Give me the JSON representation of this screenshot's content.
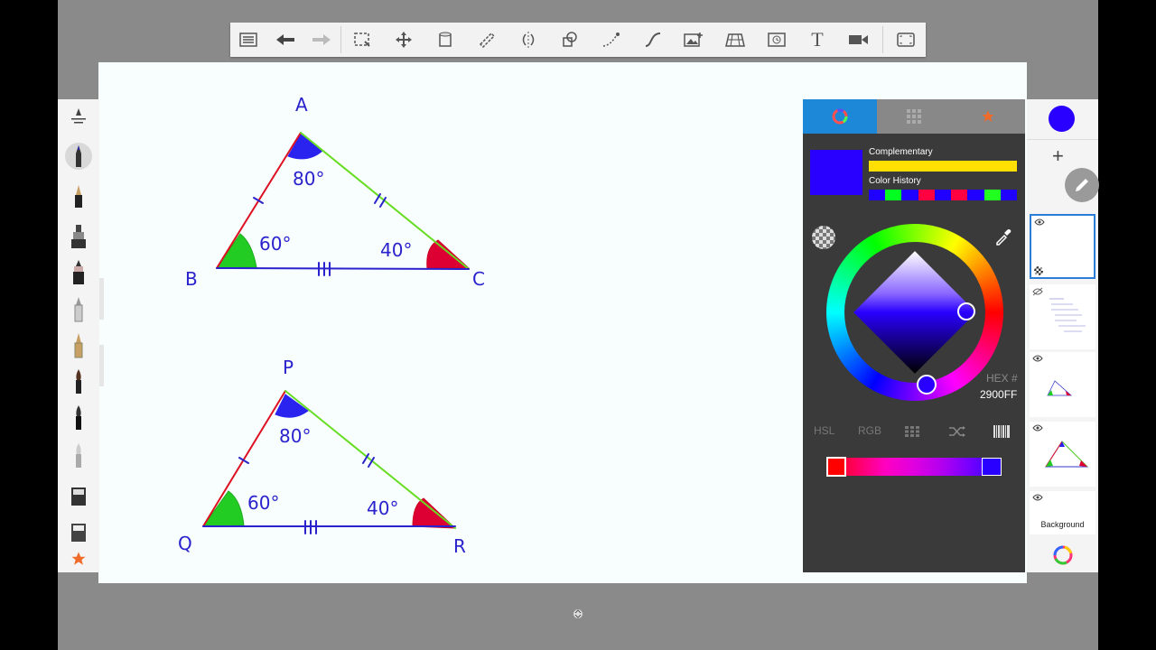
{
  "toolbar": {
    "icons": [
      "list-icon",
      "undo-icon",
      "redo-icon",
      "selection-icon",
      "transform-icon",
      "fill-icon",
      "ruler-icon",
      "symmetry-icon",
      "shape-icon",
      "stroke-icon",
      "curve-icon",
      "image-icon",
      "perspective-icon",
      "time-lapse-icon",
      "text-icon",
      "video-icon",
      "fullscreen-icon"
    ],
    "text_tool_glyph": "T"
  },
  "canvas": {
    "triangle1": {
      "vertices": [
        "A",
        "B",
        "C"
      ],
      "angles": [
        "80°",
        "60°",
        "40°"
      ]
    },
    "triangle2": {
      "vertices": [
        "P",
        "Q",
        "R"
      ],
      "angles": [
        "80°",
        "60°",
        "40°"
      ]
    }
  },
  "brushes": [
    "pencil",
    "ballpoint",
    "marker",
    "airbrush",
    "inker",
    "paint-brush",
    "fountain-pen",
    "wet-brush",
    "paint-brush-2",
    "smudge",
    "eraser",
    "eraser-2",
    "favorites"
  ],
  "color_panel": {
    "tabs": [
      "color-wheel",
      "swatches",
      "favorites"
    ],
    "complementary_label": "Complementary",
    "history_label": "Color History",
    "history": [
      "#2000ff",
      "#00ff20",
      "#2000ff",
      "#ff0040",
      "#2000ff",
      "#ff0040",
      "#2000ff",
      "#20ff20",
      "#2000ff"
    ],
    "current_color": "#2900FF",
    "complementary_color": "#FFE000",
    "hex_label": "HEX #",
    "hex_value": "2900FF",
    "modes": [
      "HSL",
      "RGB"
    ]
  },
  "layers": {
    "add_label": "+",
    "background_label": "Background",
    "selected_index": 0
  }
}
